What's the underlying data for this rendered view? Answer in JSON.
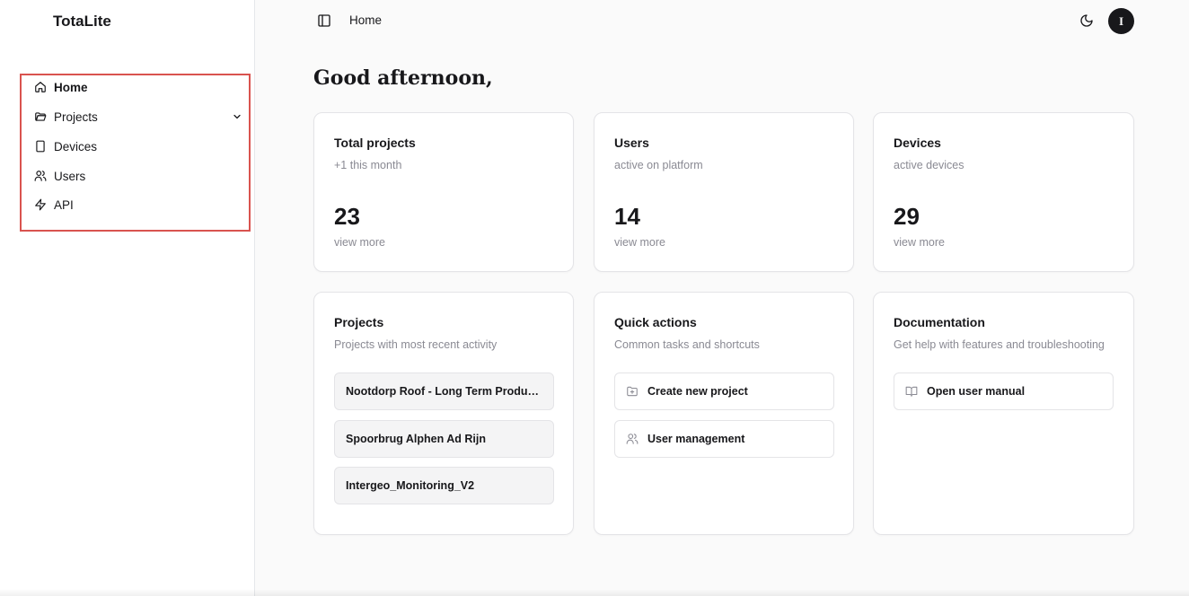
{
  "app": {
    "name": "TotaLite"
  },
  "sidebar": {
    "items": [
      {
        "label": "Home",
        "icon": "home-icon",
        "active": true
      },
      {
        "label": "Projects",
        "icon": "folder-icon",
        "expandable": true
      },
      {
        "label": "Devices",
        "icon": "tablet-icon"
      },
      {
        "label": "Users",
        "icon": "users-icon"
      },
      {
        "label": "API",
        "icon": "zap-icon"
      }
    ],
    "highlight_color": "#d9534f"
  },
  "header": {
    "breadcrumb": "Home",
    "avatar_initial": "I"
  },
  "main": {
    "greeting": "Good afternoon,",
    "stats": [
      {
        "title": "Total projects",
        "subtitle": "+1 this month",
        "value": "23",
        "link": "view more"
      },
      {
        "title": "Users",
        "subtitle": "active on platform",
        "value": "14",
        "link": "view more"
      },
      {
        "title": "Devices",
        "subtitle": "active devices",
        "value": "29",
        "link": "view more"
      }
    ],
    "projects": {
      "title": "Projects",
      "subtitle": "Projects with most recent activity",
      "items": [
        "Nootdorp Roof - Long Term Producti...",
        "Spoorbrug Alphen Ad Rijn",
        "Intergeo_Monitoring_V2"
      ]
    },
    "quick_actions": {
      "title": "Quick actions",
      "subtitle": "Common tasks and shortcuts",
      "items": [
        {
          "label": "Create new project",
          "icon": "folder-plus-icon"
        },
        {
          "label": "User management",
          "icon": "users-icon"
        }
      ]
    },
    "documentation": {
      "title": "Documentation",
      "subtitle": "Get help with features and troubleshooting",
      "items": [
        {
          "label": "Open user manual",
          "icon": "book-open-icon"
        }
      ]
    }
  }
}
